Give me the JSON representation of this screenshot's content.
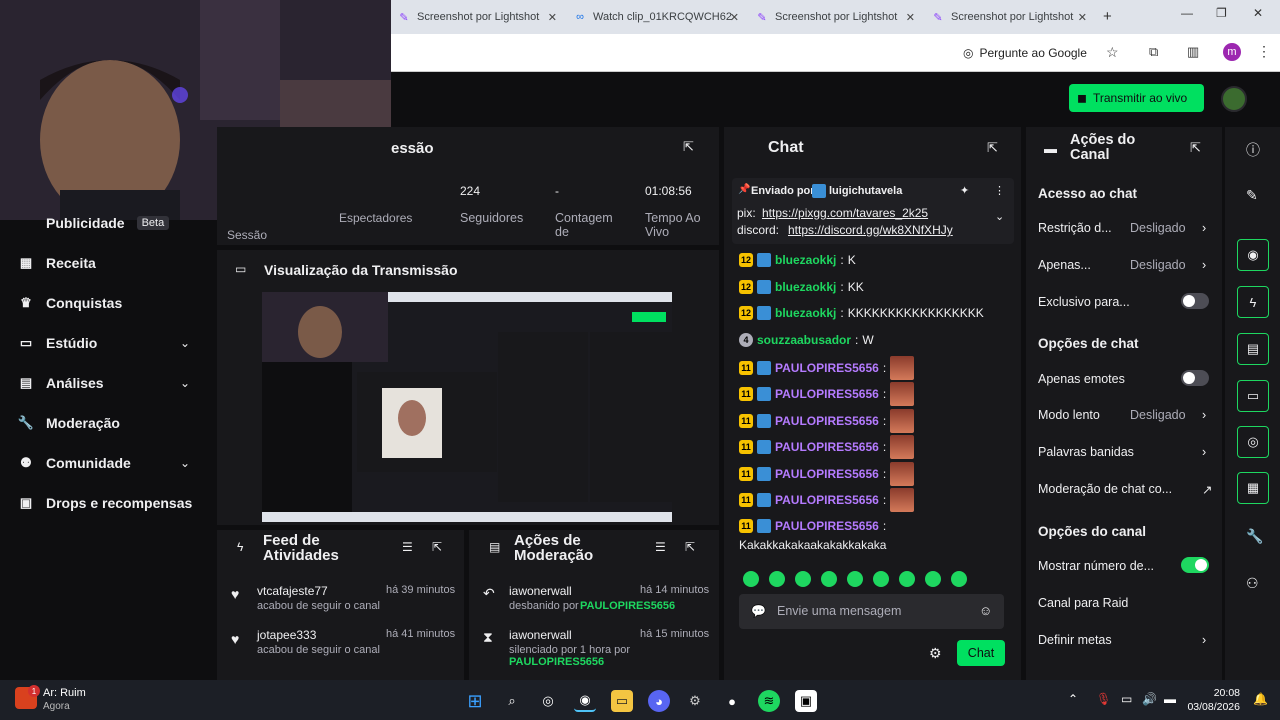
{
  "browser": {
    "tabs": [
      {
        "label": "Screenshot por Lightshot"
      },
      {
        "label": "Watch clip_01KRCQWCH62"
      },
      {
        "label": "Screenshot por Lightshot"
      },
      {
        "label": "Screenshot por Lightshot"
      }
    ],
    "google_button": "Pergunte ao Google",
    "profile_letter": "m"
  },
  "topbar": {
    "transmit_label": "Transmitir ao vivo"
  },
  "sidebar": {
    "items": [
      {
        "label": "Publicidade",
        "badge": "Beta"
      },
      {
        "label": "Receita"
      },
      {
        "label": "Conquistas"
      },
      {
        "label": "Estúdio"
      },
      {
        "label": "Análises"
      },
      {
        "label": "Moderação"
      },
      {
        "label": "Comunidade"
      },
      {
        "label": "Drops e recompensas"
      }
    ]
  },
  "session": {
    "title": "essão",
    "stats": [
      {
        "value": "",
        "label": "Espectadores"
      },
      {
        "value": "224",
        "label": "Seguidores"
      },
      {
        "value": "-",
        "label": "Contagem de"
      },
      {
        "value": "01:08:56",
        "label": "Tempo Ao Vivo"
      }
    ],
    "extra_label": "Sessão"
  },
  "preview": {
    "title": "Visualização da Transmissão"
  },
  "feed": {
    "title": "Feed de Atividades",
    "items": [
      {
        "user": "vtcafajeste77",
        "time": "há 39 minutos",
        "action": "acabou de seguir o canal"
      },
      {
        "user": "jotapee333",
        "time": "há 41 minutos",
        "action": "acabou de seguir o canal"
      }
    ]
  },
  "modactions": {
    "title": "Ações de Moderação",
    "items": [
      {
        "user": "iawonerwall",
        "time": "há 14 minutos",
        "action": "desbanido por",
        "by": "PAULOPIRES5656"
      },
      {
        "user": "iawonerwall",
        "time": "há 15 minutos",
        "action": "silenciado por 1 hora por",
        "by": "PAULOPIRES5656"
      }
    ]
  },
  "chat": {
    "title": "Chat",
    "pinned": {
      "sent_by": "Enviado por",
      "user": "luigichutavela",
      "line1_label": "pix:",
      "line1_link": "https://pixgg.com/tavares_2k25",
      "line2_label": "discord:",
      "line2_link": "https://discord.gg/wk8XNfXHJy"
    },
    "messages": [
      {
        "badge": "12",
        "user": "bluezaokkj",
        "text": "K"
      },
      {
        "badge": "12",
        "user": "bluezaokkj",
        "text": "KK"
      },
      {
        "badge": "12",
        "user": "bluezaokkj",
        "text": "KKKKKKKKKKKKKKKKK"
      },
      {
        "badge": "4",
        "user": "souzzaabusador",
        "text": "W"
      },
      {
        "badge": "11",
        "user": "PAULOPIRES5656",
        "text": ""
      },
      {
        "badge": "11",
        "user": "PAULOPIRES5656",
        "text": ""
      },
      {
        "badge": "11",
        "user": "PAULOPIRES5656",
        "text": ""
      },
      {
        "badge": "11",
        "user": "PAULOPIRES5656",
        "text": ""
      },
      {
        "badge": "11",
        "user": "PAULOPIRES5656",
        "text": ""
      },
      {
        "badge": "11",
        "user": "PAULOPIRES5656",
        "text": ""
      },
      {
        "badge": "11",
        "user": "PAULOPIRES5656",
        "text": "Kakakkakakaakakakkakaka"
      }
    ],
    "input_placeholder": "Envie uma mensagem",
    "send_label": "Chat"
  },
  "actions": {
    "title": "Ações do Canal",
    "sections": [
      {
        "heading": "Acesso ao chat"
      },
      {
        "heading": "Opções de chat"
      },
      {
        "heading": "Opções do canal"
      }
    ],
    "rows": [
      {
        "label": "Restrição d...",
        "value": "Desligado"
      },
      {
        "label": "Apenas...",
        "value": "Desligado"
      },
      {
        "label": "Exclusivo para..."
      },
      {
        "label": "Apenas emotes"
      },
      {
        "label": "Modo lento",
        "value": "Desligado"
      },
      {
        "label": "Palavras banidas"
      },
      {
        "label": "Moderação de chat co..."
      },
      {
        "label": "Mostrar número de..."
      },
      {
        "label": "Canal para Raid"
      },
      {
        "label": "Definir metas"
      }
    ]
  },
  "taskbar": {
    "weather": "Ar: Ruim",
    "weather_sub": "Agora",
    "weather_badge": "1",
    "time": "20:08",
    "date": "03/08/2026"
  },
  "colors": {
    "accent": "#1ed760",
    "panel": "#18181b",
    "bg": "#0e0e10",
    "purple": "#b57bff"
  }
}
